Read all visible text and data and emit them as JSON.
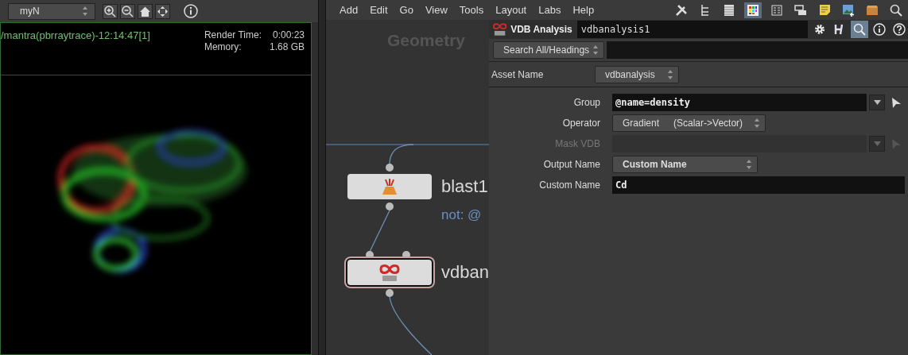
{
  "viewer": {
    "camera_menu": "myN",
    "tools": [
      {
        "kind": "zoom_in"
      },
      {
        "kind": "zoom_out"
      },
      {
        "kind": "home"
      },
      {
        "kind": "frame"
      },
      {
        "kind": "info"
      }
    ],
    "render_label": "/mantra(pbrraytrace)-12:14:47[1]",
    "stats": [
      {
        "label": "Render Time:",
        "value": "0:00:23"
      },
      {
        "label": "Memory:",
        "value": "1.68 GB"
      }
    ]
  },
  "network": {
    "menu": [
      "Add",
      "Edit",
      "Go",
      "View",
      "Tools",
      "Layout",
      "Labs",
      "Help"
    ],
    "tools": [
      {
        "kind": "tools",
        "selected": false
      },
      {
        "kind": "tree",
        "selected": false
      },
      {
        "kind": "list",
        "selected": false
      },
      {
        "kind": "grid",
        "selected": true
      },
      {
        "kind": "grid_small",
        "selected": false
      },
      {
        "kind": "net_box",
        "selected": false
      },
      {
        "kind": "note",
        "selected": false
      },
      {
        "kind": "image",
        "selected": false
      },
      {
        "kind": "box",
        "selected": false
      },
      {
        "kind": "search",
        "selected": false
      }
    ],
    "context_label": "Geometry",
    "nodes": [
      {
        "kind": "blast",
        "name": "blast1",
        "comment": "not: @",
        "selected": false
      },
      {
        "kind": "vdb",
        "name": "vdban",
        "selected": true
      }
    ]
  },
  "parameters": {
    "node_type": "VDB Analysis",
    "node_name": "vdbanalysis1",
    "tools": [
      {
        "kind": "gear",
        "selected": false
      },
      {
        "kind": "h",
        "selected": false
      },
      {
        "kind": "search",
        "selected": true
      },
      {
        "kind": "info",
        "selected": false
      },
      {
        "kind": "help",
        "selected": false
      }
    ],
    "search_mode": "Search All/Headings",
    "asset_name_label": "Asset Name",
    "asset_name": "vdbanalysis",
    "fields": [
      {
        "kind": "text_menu",
        "label": "Group",
        "value": "@name=density",
        "disabled": false
      },
      {
        "kind": "menu",
        "label": "Operator",
        "value": "Gradient",
        "detail": "(Scalar->Vector)",
        "modified": false,
        "disabled": false
      },
      {
        "kind": "text_menu",
        "label": "Mask VDB",
        "disabled": true
      },
      {
        "kind": "menu",
        "label": "Output Name",
        "value": "Custom Name",
        "modified": true,
        "disabled": false
      },
      {
        "kind": "text",
        "label": "Custom Name",
        "value": "Cd",
        "disabled": false
      }
    ]
  }
}
